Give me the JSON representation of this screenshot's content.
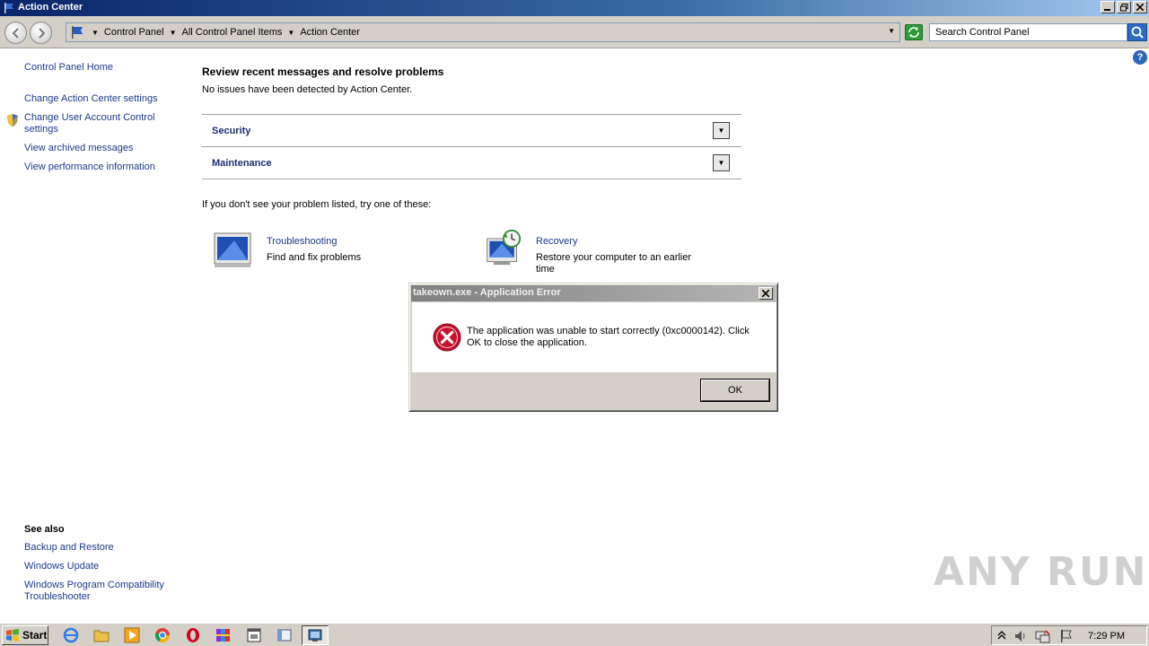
{
  "window": {
    "title": "Action Center",
    "buttons": [
      "minimize",
      "restore",
      "close"
    ]
  },
  "address": {
    "breadcrumbs": [
      "Control Panel",
      "All Control Panel Items",
      "Action Center"
    ],
    "search_placeholder": "Search Control Panel"
  },
  "sidebar": {
    "home": "Control Panel Home",
    "links": [
      "Change Action Center settings",
      "Change User Account Control settings",
      "View archived messages",
      "View performance information"
    ],
    "see_also_heading": "See also",
    "see_also": [
      "Backup and Restore",
      "Windows Update",
      "Windows Program Compatibility Troubleshooter"
    ]
  },
  "main": {
    "heading": "Review recent messages and resolve problems",
    "status": "No issues have been detected by Action Center.",
    "sections": [
      "Security",
      "Maintenance"
    ],
    "try_line": "If you don't see your problem listed, try one of these:",
    "tiles": [
      {
        "title": "Troubleshooting",
        "desc": "Find and fix problems"
      },
      {
        "title": "Recovery",
        "desc": "Restore your computer to an earlier time"
      }
    ]
  },
  "dialog": {
    "title": "takeown.exe - Application Error",
    "message": "The application was unable to start correctly (0xc0000142). Click OK to close the application.",
    "ok_label": "OK"
  },
  "watermark": "ANY RUN",
  "taskbar": {
    "start_label": "Start",
    "clock": "7:29 PM",
    "icons": [
      "ie-icon",
      "explorer-icon",
      "media-player-icon",
      "chrome-icon",
      "opera-icon",
      "winrar-icon",
      "program-icon",
      "control-panel-icon",
      "action-center-icon"
    ]
  },
  "colors": {
    "link": "#1c3a8a",
    "titlebar_start": "#0a246a",
    "error_red": "#c8102e"
  }
}
